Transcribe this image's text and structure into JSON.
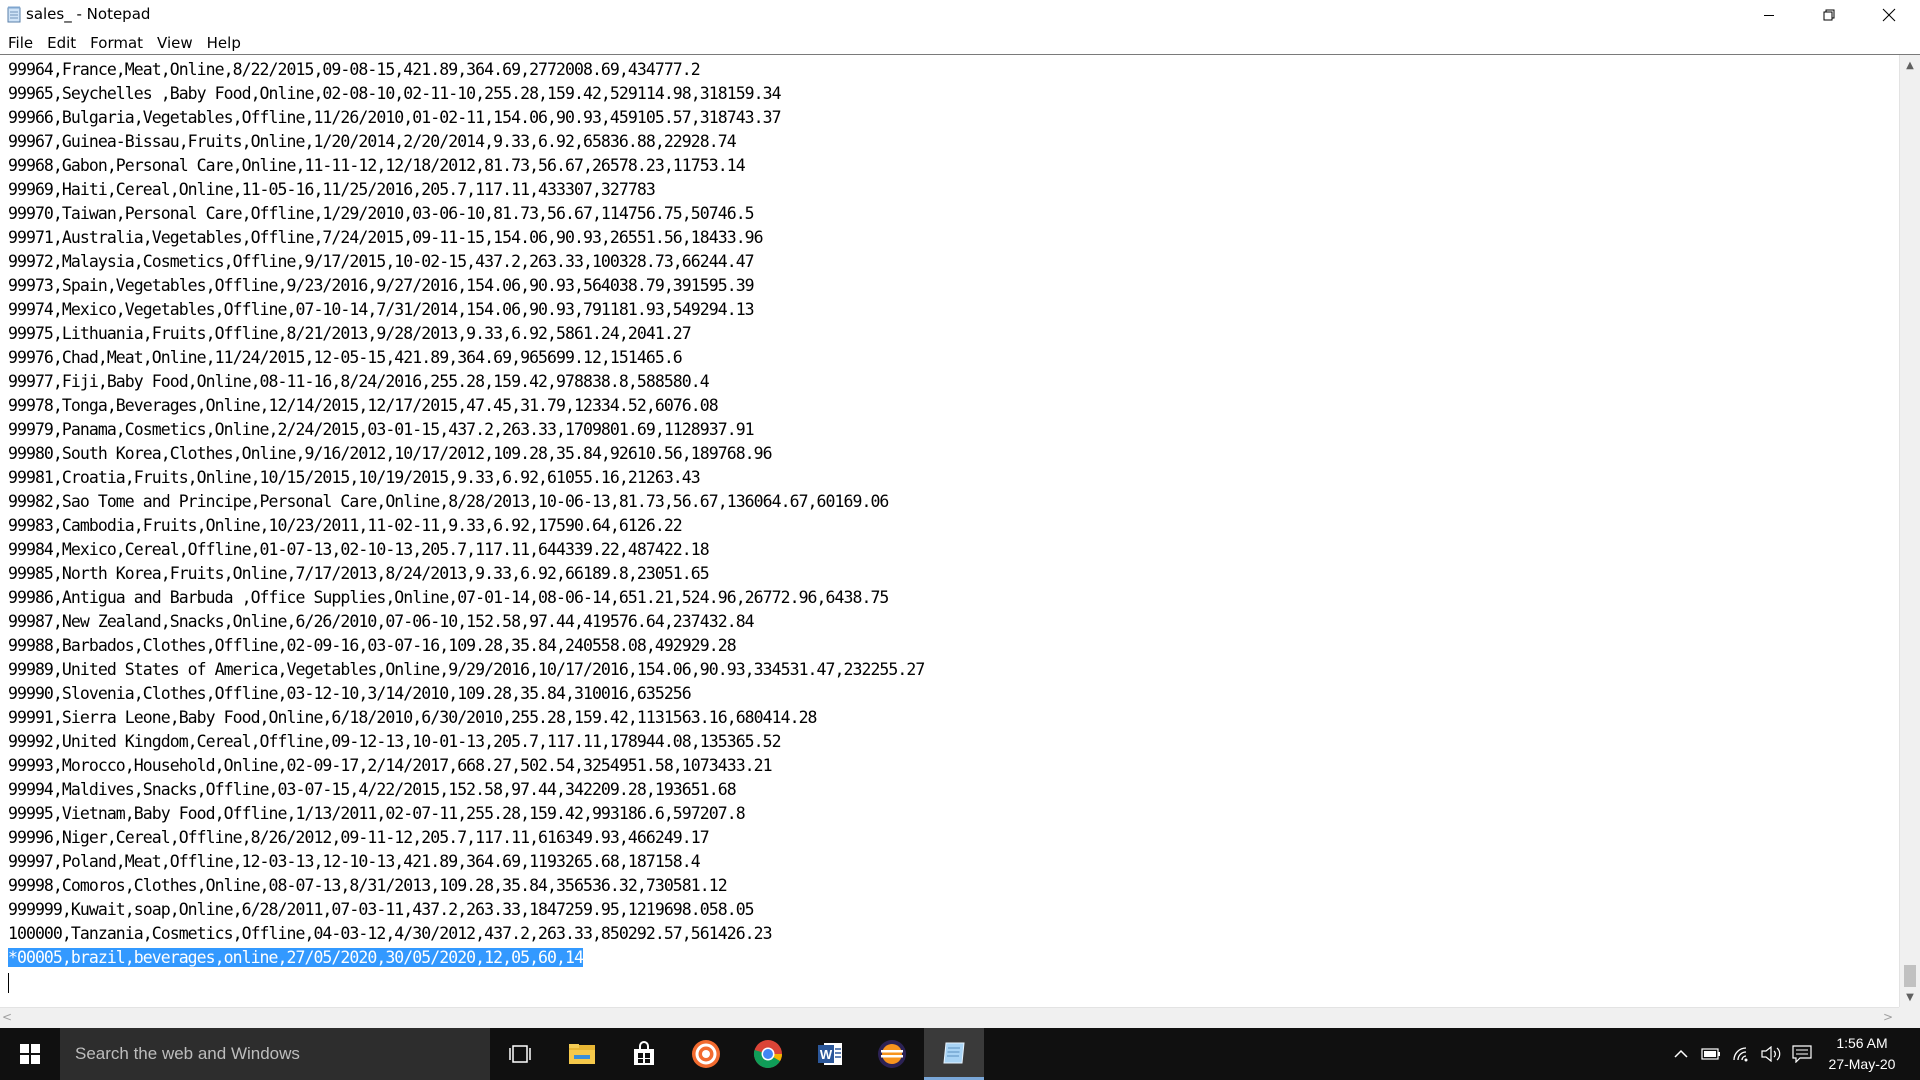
{
  "window": {
    "title": "sales_ - Notepad"
  },
  "menu": [
    {
      "label": "File"
    },
    {
      "label": "Edit"
    },
    {
      "label": "Format"
    },
    {
      "label": "View"
    },
    {
      "label": "Help"
    }
  ],
  "document": {
    "lines": [
      "99964,France,Meat,Online,8/22/2015,09-08-15,421.89,364.69,2772008.69,434777.2",
      "99965,Seychelles ,Baby Food,Online,02-08-10,02-11-10,255.28,159.42,529114.98,318159.34",
      "99966,Bulgaria,Vegetables,Offline,11/26/2010,01-02-11,154.06,90.93,459105.57,318743.37",
      "99967,Guinea-Bissau,Fruits,Online,1/20/2014,2/20/2014,9.33,6.92,65836.88,22928.74",
      "99968,Gabon,Personal Care,Online,11-11-12,12/18/2012,81.73,56.67,26578.23,11753.14",
      "99969,Haiti,Cereal,Online,11-05-16,11/25/2016,205.7,117.11,433307,327783",
      "99970,Taiwan,Personal Care,Offline,1/29/2010,03-06-10,81.73,56.67,114756.75,50746.5",
      "99971,Australia,Vegetables,Offline,7/24/2015,09-11-15,154.06,90.93,26551.56,18433.96",
      "99972,Malaysia,Cosmetics,Offline,9/17/2015,10-02-15,437.2,263.33,100328.73,66244.47",
      "99973,Spain,Vegetables,Offline,9/23/2016,9/27/2016,154.06,90.93,564038.79,391595.39",
      "99974,Mexico,Vegetables,Offline,07-10-14,7/31/2014,154.06,90.93,791181.93,549294.13",
      "99975,Lithuania,Fruits,Offline,8/21/2013,9/28/2013,9.33,6.92,5861.24,2041.27",
      "99976,Chad,Meat,Online,11/24/2015,12-05-15,421.89,364.69,965699.12,151465.6",
      "99977,Fiji,Baby Food,Online,08-11-16,8/24/2016,255.28,159.42,978838.8,588580.4",
      "99978,Tonga,Beverages,Online,12/14/2015,12/17/2015,47.45,31.79,12334.52,6076.08",
      "99979,Panama,Cosmetics,Online,2/24/2015,03-01-15,437.2,263.33,1709801.69,1128937.91",
      "99980,South Korea,Clothes,Online,9/16/2012,10/17/2012,109.28,35.84,92610.56,189768.96",
      "99981,Croatia,Fruits,Online,10/15/2015,10/19/2015,9.33,6.92,61055.16,21263.43",
      "99982,Sao Tome and Principe,Personal Care,Online,8/28/2013,10-06-13,81.73,56.67,136064.67,60169.06",
      "99983,Cambodia,Fruits,Online,10/23/2011,11-02-11,9.33,6.92,17590.64,6126.22",
      "99984,Mexico,Cereal,Offline,01-07-13,02-10-13,205.7,117.11,644339.22,487422.18",
      "99985,North Korea,Fruits,Online,7/17/2013,8/24/2013,9.33,6.92,66189.8,23051.65",
      "99986,Antigua and Barbuda ,Office Supplies,Online,07-01-14,08-06-14,651.21,524.96,26772.96,6438.75",
      "99987,New Zealand,Snacks,Online,6/26/2010,07-06-10,152.58,97.44,419576.64,237432.84",
      "99988,Barbados,Clothes,Offline,02-09-16,03-07-16,109.28,35.84,240558.08,492929.28",
      "99989,United States of America,Vegetables,Online,9/29/2016,10/17/2016,154.06,90.93,334531.47,232255.27",
      "99990,Slovenia,Clothes,Offline,03-12-10,3/14/2010,109.28,35.84,310016,635256",
      "99991,Sierra Leone,Baby Food,Online,6/18/2010,6/30/2010,255.28,159.42,1131563.16,680414.28",
      "99992,United Kingdom,Cereal,Offline,09-12-13,10-01-13,205.7,117.11,178944.08,135365.52",
      "99993,Morocco,Household,Online,02-09-17,2/14/2017,668.27,502.54,3254951.58,1073433.21",
      "99994,Maldives,Snacks,Offline,03-07-15,4/22/2015,152.58,97.44,342209.28,193651.68",
      "99995,Vietnam,Baby Food,Offline,1/13/2011,02-07-11,255.28,159.42,993186.6,597207.8",
      "99996,Niger,Cereal,Offline,8/26/2012,09-11-12,205.7,117.11,616349.93,466249.17",
      "99997,Poland,Meat,Offline,12-03-13,12-10-13,421.89,364.69,1193265.68,187158.4",
      "99998,Comoros,Clothes,Online,08-07-13,8/31/2013,109.28,35.84,356536.32,730581.12",
      "999999,Kuwait,soap,Online,6/28/2011,07-03-11,437.2,263.33,1847259.95,1219698.058.05",
      "100000,Tanzania,Cosmetics,Offline,04-03-12,4/30/2012,437.2,263.33,850292.57,561426.23"
    ],
    "selected_line": "*00005,brazil,beverages,online,27/05/2020,30/05/2020,12,05,60,14"
  },
  "taskbar": {
    "search_placeholder": "Search the web and Windows",
    "clock_time": "1:56 AM",
    "clock_date": "27-May-20"
  },
  "colors": {
    "selection": "#3399ff",
    "taskbar": "#101010",
    "search_box": "#2d2d2d"
  }
}
